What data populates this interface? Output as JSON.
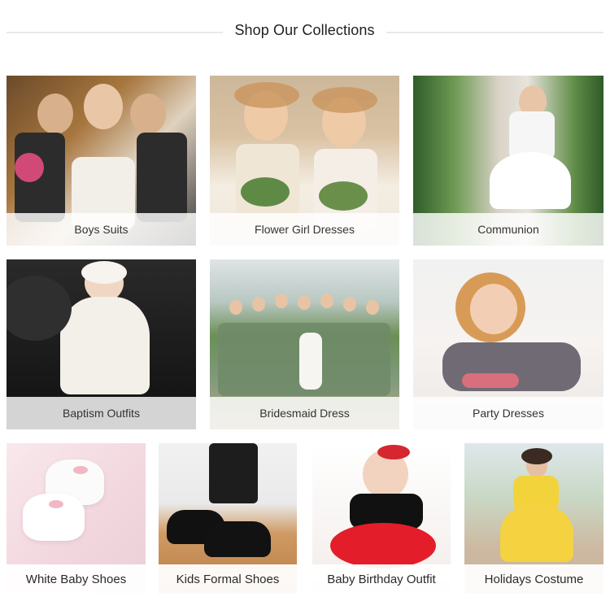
{
  "section": {
    "title": "Shop Our Collections"
  },
  "collections": [
    {
      "label": "Boys Suits"
    },
    {
      "label": "Flower Girl Dresses"
    },
    {
      "label": "Communion"
    },
    {
      "label": "Baptism Outfits"
    },
    {
      "label": "Bridesmaid Dress"
    },
    {
      "label": "Party Dresses"
    },
    {
      "label": "White Baby Shoes"
    },
    {
      "label": "Kids Formal Shoes"
    },
    {
      "label": "Baby Birthday Outfit"
    },
    {
      "label": "Holidays Costume"
    }
  ]
}
